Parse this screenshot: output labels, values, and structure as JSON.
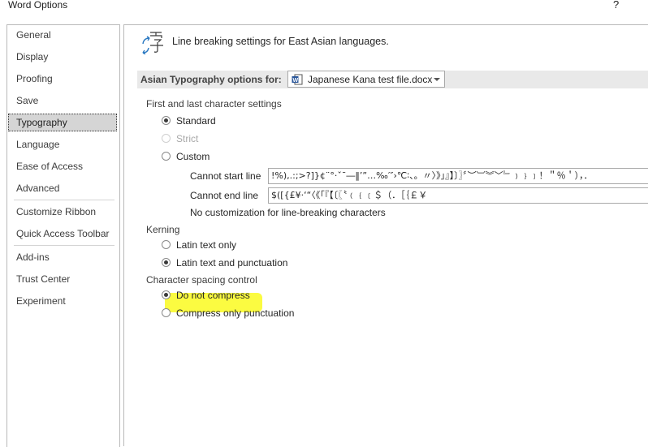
{
  "window": {
    "title": "Word Options",
    "help": "?"
  },
  "sidebar": {
    "items": [
      {
        "label": "General"
      },
      {
        "label": "Display"
      },
      {
        "label": "Proofing"
      },
      {
        "label": "Save"
      },
      {
        "label": "Typography",
        "selected": true
      },
      {
        "label": "Language"
      },
      {
        "label": "Ease of Access"
      },
      {
        "label": "Advanced"
      },
      {
        "label": "Customize Ribbon"
      },
      {
        "label": "Quick Access Toolbar"
      },
      {
        "label": "Add-ins"
      },
      {
        "label": "Trust Center"
      },
      {
        "label": "Experiment"
      }
    ]
  },
  "header": {
    "text": "Line breaking settings for East Asian languages.",
    "icon": "asian-typography-icon"
  },
  "section": {
    "label": "Asian Typography options for:",
    "document": "Japanese Kana test file.docx"
  },
  "first_last": {
    "label": "First and last character settings",
    "standard": "Standard",
    "strict": "Strict",
    "custom": "Custom",
    "cannot_start_label": "Cannot start line",
    "cannot_start_value": "!%),.:;>?]}¢¨°·ˇˉ―‖’”…‰′″›℃∶、。〃〉》」』】〕〗〞︶︺︾﹀﹄﹚﹜﹞！＂％＇），．",
    "cannot_end_label": "Cannot end line",
    "cannot_end_value": "$([{£¥·‘“〈《「『【〔〖〝﹙﹛﹝＄（．［｛￡￥",
    "no_custom": "No customization for line-breaking characters"
  },
  "kerning": {
    "label": "Kerning",
    "latin_only": "Latin text only",
    "latin_punct": "Latin text and punctuation"
  },
  "spacing": {
    "label": "Character spacing control",
    "no_compress": "Do not compress",
    "compress_punct": "Compress only punctuation"
  },
  "colors": {
    "highlight": "#fbfb2c",
    "selected_bg": "#d5d5d5",
    "section_bar": "#e9e9e9"
  }
}
